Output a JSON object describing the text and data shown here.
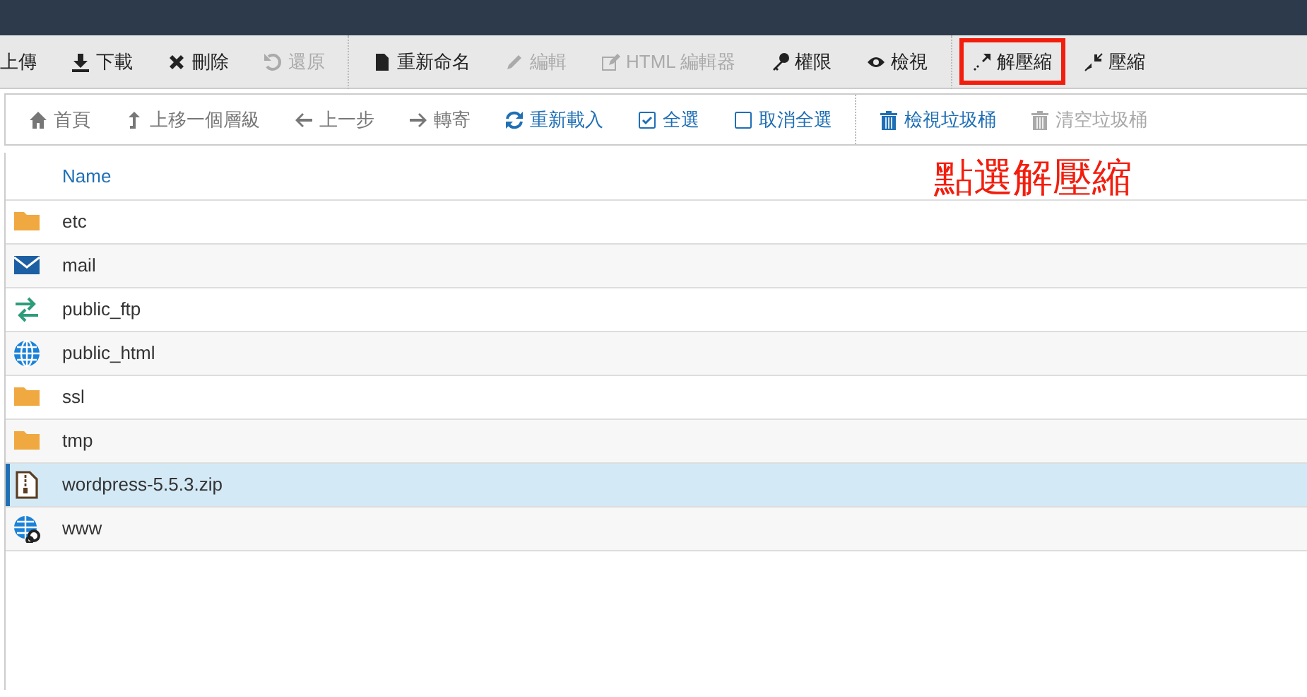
{
  "toolbar": [
    {
      "label": "上傳",
      "disabled": false,
      "highlighted": false
    },
    {
      "label": "下載",
      "disabled": false,
      "highlighted": false
    },
    {
      "label": "刪除",
      "disabled": false,
      "highlighted": false
    },
    {
      "label": "還原",
      "disabled": true,
      "highlighted": false
    },
    {
      "label": "重新命名",
      "disabled": false,
      "highlighted": false
    },
    {
      "label": "編輯",
      "disabled": true,
      "highlighted": false
    },
    {
      "label": "HTML 編輯器",
      "disabled": true,
      "highlighted": false
    },
    {
      "label": "權限",
      "disabled": false,
      "highlighted": false
    },
    {
      "label": "檢視",
      "disabled": false,
      "highlighted": false
    },
    {
      "label": "解壓縮",
      "disabled": false,
      "highlighted": true
    },
    {
      "label": "壓縮",
      "disabled": false,
      "highlighted": false
    }
  ],
  "navbar": [
    {
      "label": "首頁",
      "kind": "plain",
      "disabled": false
    },
    {
      "label": "上移一個層級",
      "kind": "plain",
      "disabled": false
    },
    {
      "label": "上一步",
      "kind": "plain",
      "disabled": false
    },
    {
      "label": "轉寄",
      "kind": "plain",
      "disabled": false
    },
    {
      "label": "重新載入",
      "kind": "link",
      "disabled": false
    },
    {
      "label": "全選",
      "kind": "link",
      "disabled": false
    },
    {
      "label": "取消全選",
      "kind": "link",
      "disabled": false
    },
    {
      "label": "檢視垃圾桶",
      "kind": "link",
      "disabled": false
    },
    {
      "label": "清空垃圾桶",
      "kind": "link",
      "disabled": true
    }
  ],
  "table": {
    "columns": [
      "Name"
    ],
    "rows": [
      {
        "name": "etc",
        "kind": "folder",
        "selected": false
      },
      {
        "name": "mail",
        "kind": "mail",
        "selected": false
      },
      {
        "name": "public_ftp",
        "kind": "ftp",
        "selected": false
      },
      {
        "name": "public_html",
        "kind": "globe",
        "selected": false
      },
      {
        "name": "ssl",
        "kind": "folder",
        "selected": false
      },
      {
        "name": "tmp",
        "kind": "folder",
        "selected": false
      },
      {
        "name": "wordpress-5.5.3.zip",
        "kind": "zip",
        "selected": true
      },
      {
        "name": "www",
        "kind": "globe-link",
        "selected": false
      }
    ]
  },
  "annotation": "點選解壓縮"
}
